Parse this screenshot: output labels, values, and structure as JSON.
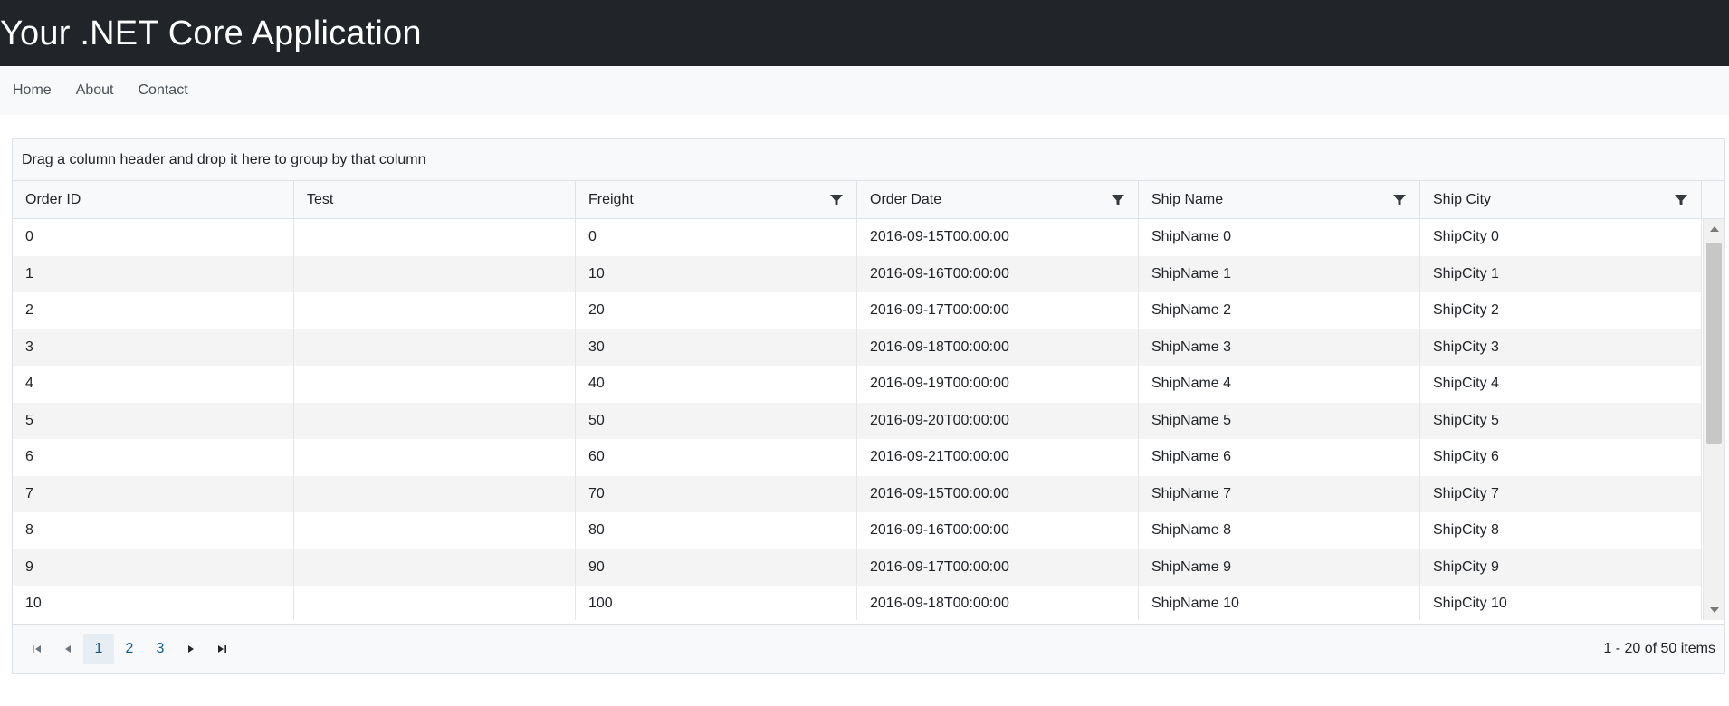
{
  "header": {
    "title": "Your .NET Core Application"
  },
  "nav": {
    "items": [
      "Home",
      "About",
      "Contact"
    ]
  },
  "grid": {
    "group_panel_text": "Drag a column header and drop it here to group by that column",
    "columns": [
      "Order ID",
      "Test",
      "Freight",
      "Order Date",
      "Ship Name",
      "Ship City"
    ],
    "rows": [
      [
        "0",
        "",
        "0",
        "2016-09-15T00:00:00",
        "ShipName 0",
        "ShipCity 0"
      ],
      [
        "1",
        "",
        "10",
        "2016-09-16T00:00:00",
        "ShipName 1",
        "ShipCity 1"
      ],
      [
        "2",
        "",
        "20",
        "2016-09-17T00:00:00",
        "ShipName 2",
        "ShipCity 2"
      ],
      [
        "3",
        "",
        "30",
        "2016-09-18T00:00:00",
        "ShipName 3",
        "ShipCity 3"
      ],
      [
        "4",
        "",
        "40",
        "2016-09-19T00:00:00",
        "ShipName 4",
        "ShipCity 4"
      ],
      [
        "5",
        "",
        "50",
        "2016-09-20T00:00:00",
        "ShipName 5",
        "ShipCity 5"
      ],
      [
        "6",
        "",
        "60",
        "2016-09-21T00:00:00",
        "ShipName 6",
        "ShipCity 6"
      ],
      [
        "7",
        "",
        "70",
        "2016-09-15T00:00:00",
        "ShipName 7",
        "ShipCity 7"
      ],
      [
        "8",
        "",
        "80",
        "2016-09-16T00:00:00",
        "ShipName 8",
        "ShipCity 8"
      ],
      [
        "9",
        "",
        "90",
        "2016-09-17T00:00:00",
        "ShipName 9",
        "ShipCity 9"
      ],
      [
        "10",
        "",
        "100",
        "2016-09-18T00:00:00",
        "ShipName 10",
        "ShipCity 10"
      ]
    ]
  },
  "pager": {
    "pages": [
      "1",
      "2",
      "3"
    ],
    "info": "1 - 20 of 50 items"
  }
}
